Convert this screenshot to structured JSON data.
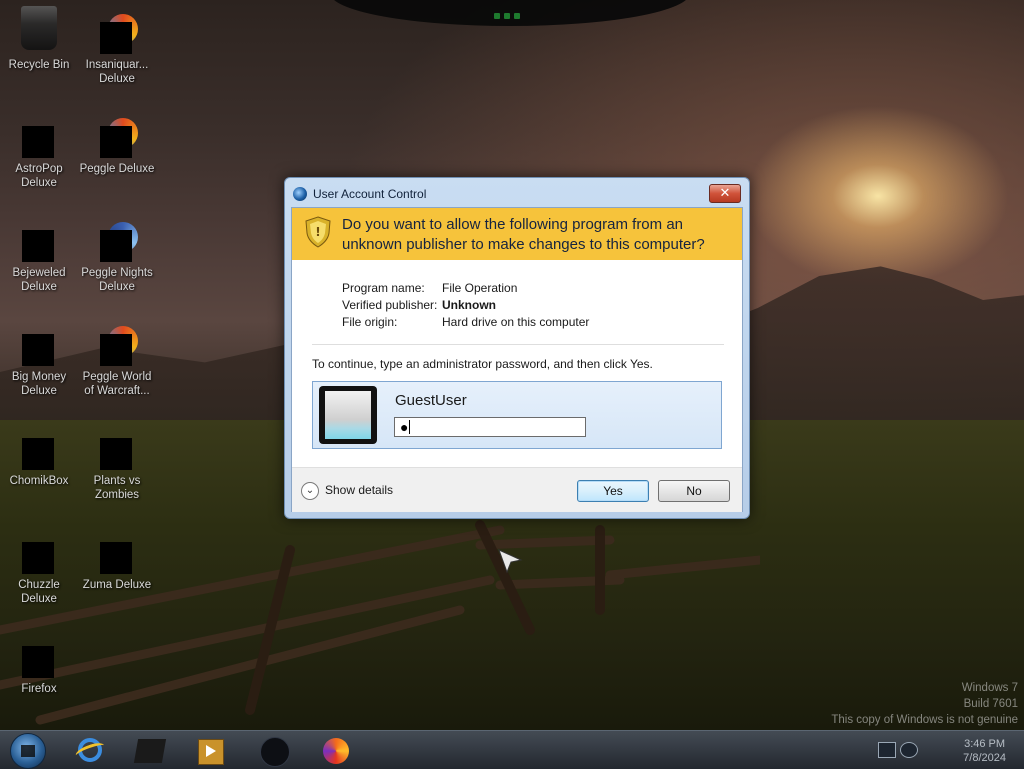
{
  "desktop": {
    "icons": [
      {
        "label": "Recycle Bin"
      },
      {
        "label": "Insaniquar... Deluxe"
      },
      {
        "label": "AstroPop Deluxe"
      },
      {
        "label": "Peggle Deluxe"
      },
      {
        "label": "Bejeweled Deluxe"
      },
      {
        "label": "Peggle Nights Deluxe"
      },
      {
        "label": "Big Money Deluxe"
      },
      {
        "label": "Peggle World of Warcraft..."
      },
      {
        "label": "ChomikBox"
      },
      {
        "label": "Plants vs Zombies"
      },
      {
        "label": "Chuzzle Deluxe"
      },
      {
        "label": "Zuma Deluxe"
      },
      {
        "label": "Firefox"
      }
    ],
    "watermark": {
      "line1": "Windows 7",
      "line2": "Build 7601",
      "line3": "This copy of Windows is not genuine"
    }
  },
  "uac": {
    "title": "User Account Control",
    "close_icon": "✕",
    "question": "Do you want to allow the following program from an unknown publisher to make changes to this computer?",
    "details": [
      {
        "key": "Program name:",
        "value": "File Operation"
      },
      {
        "key": "Verified publisher:",
        "value": "Unknown"
      },
      {
        "key": "File origin:",
        "value": "Hard drive on this computer"
      }
    ],
    "instruction": "To continue, type an administrator password, and then click Yes.",
    "credential": {
      "username": "GuestUser",
      "password_value": "●"
    },
    "show_details_label": "Show details",
    "show_details_icon": "⌄",
    "yes_label": "Yes",
    "no_label": "No",
    "banner_color": "#f6c33b"
  },
  "taskbar": {
    "items": [
      "start-orb",
      "internet-explorer-icon",
      "app-icon",
      "media-player-icon",
      "app-circle-icon",
      "firefox-icon"
    ],
    "clock": {
      "time": "3:46 PM",
      "date": "7/8/2024"
    }
  }
}
